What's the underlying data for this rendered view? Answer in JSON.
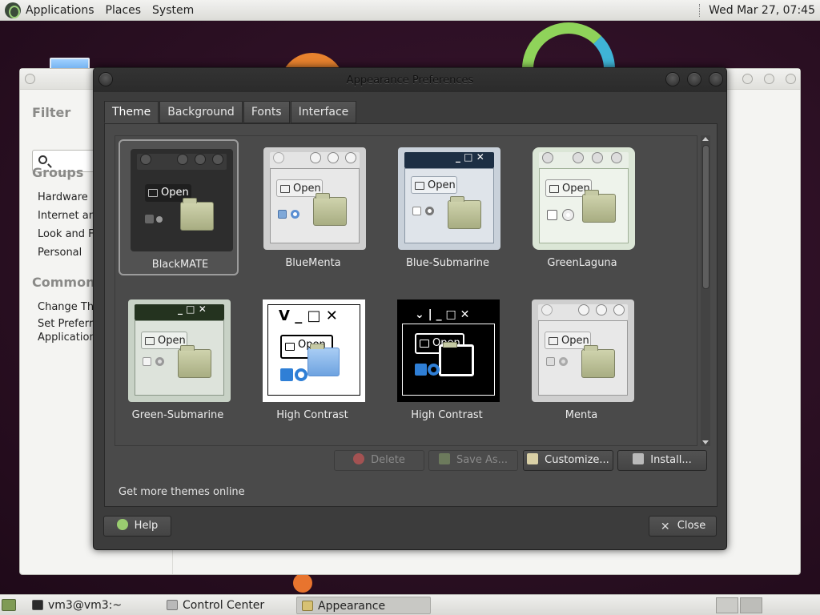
{
  "top_panel": {
    "menus": [
      "Applications",
      "Places",
      "System"
    ],
    "clock": "Wed Mar 27, 07:45"
  },
  "control_center": {
    "filter_title": "Filter",
    "search_placeholder": "",
    "groups_title": "Groups",
    "groups": [
      "Hardware",
      "Internet and",
      "Look and Fe",
      "Personal"
    ],
    "common_title": "Common T",
    "common_items": [
      "Change The",
      "Set Preferre",
      "Application"
    ]
  },
  "dialog": {
    "title": "Appearance Preferences",
    "tabs": [
      "Theme",
      "Background",
      "Fonts",
      "Interface"
    ],
    "active_tab": "Theme",
    "themes": [
      {
        "name": "BlackMATE",
        "style": "dark",
        "selected": true
      },
      {
        "name": "BlueMenta",
        "style": "menta",
        "selected": false
      },
      {
        "name": "Blue-Submarine",
        "style": "submarine-blue",
        "selected": false
      },
      {
        "name": "GreenLaguna",
        "style": "laguna",
        "selected": false
      },
      {
        "name": "Green-Submarine",
        "style": "submarine-green",
        "selected": false
      },
      {
        "name": "High Contrast",
        "style": "hc-light",
        "selected": false
      },
      {
        "name": "High Contrast",
        "style": "hc-dark",
        "selected": false
      },
      {
        "name": "Menta",
        "style": "menta-gray",
        "selected": false
      }
    ],
    "thumb_open_label": "Open",
    "buttons": {
      "delete": "Delete",
      "save_as": "Save As...",
      "customize": "Customize...",
      "install": "Install..."
    },
    "more_themes_link": "Get more themes online",
    "help": "Help",
    "close": "Close"
  },
  "taskbar": {
    "tasks": [
      {
        "label": "vm3@vm3:~",
        "active": false
      },
      {
        "label": "Control Center",
        "active": false
      },
      {
        "label": "Appearance Prefere...",
        "active": true
      }
    ]
  },
  "colors": {
    "dialog_bg": "#3c3c3c",
    "selection_border": "#9c9c9c",
    "submarine_blue_bar": "#1d2f44",
    "submarine_green_bar": "#24331f",
    "hc_check": "#2f7fd6"
  }
}
